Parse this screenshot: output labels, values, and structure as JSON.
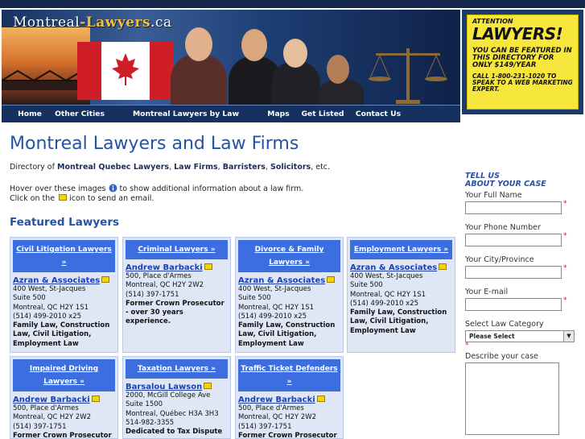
{
  "header": {
    "logo_main": "Montreal",
    "logo_accent": "-Lawyers",
    "logo_tld": ".ca"
  },
  "ad": {
    "line1": "ATTENTION",
    "line2": "LAWYERS!",
    "line3": "YOU CAN BE FEATURED IN THIS DIRECTORY FOR ONLY $149/YEAR",
    "line4": "CALL 1-800-231-1020 TO SPEAK TO A WEB MARKETING EXPERT."
  },
  "nav": {
    "items": [
      {
        "label": "Home"
      },
      {
        "label": "Other Cities"
      },
      {
        "label": "Montreal Lawyers by Law Category"
      },
      {
        "label": "Maps"
      },
      {
        "label": "Get Listed"
      },
      {
        "label": "Contact Us"
      }
    ]
  },
  "main": {
    "title": "Montreal Lawyers and Law Firms",
    "intro_prefix": "Directory of ",
    "intro_k1": "Montreal Quebec Lawyers",
    "intro_sep1": ", ",
    "intro_k2": "Law Firms",
    "intro_sep2": ", ",
    "intro_k3": "Barristers",
    "intro_sep3": ", ",
    "intro_k4": "Solicitors",
    "intro_suffix": ", etc.",
    "hover_prefix": "Hover over these images ",
    "hover_suffix": " to show additional information about a law firm.",
    "click_prefix": "Click on the ",
    "click_suffix": " icon to send an email.",
    "featured_heading": "Featured Lawyers"
  },
  "cards": [
    {
      "category": "Civil Litigation Lawyers »",
      "firm": "Azran & Associates",
      "address": [
        "400 West, St-Jacques",
        "Suite 500",
        "Montreal, QC H2Y 1S1",
        "(514) 499-2010 x25"
      ],
      "description": "Family Law, Construction Law, Civil Litigation, Employment Law"
    },
    {
      "category": "Criminal Lawyers »",
      "firm": "Andrew Barbacki",
      "address": [
        "500, Place d'Armes",
        "Montreal, QC H2Y 2W2",
        "(514) 397-1751"
      ],
      "description": "Former Crown Prosecutor - over 30 years experience."
    },
    {
      "category": "Divorce & Family Lawyers »",
      "firm": "Azran & Associates",
      "address": [
        "400 West, St-Jacques",
        "Suite 500",
        "Montreal, QC H2Y 1S1",
        "(514) 499-2010 x25"
      ],
      "description": "Family Law, Construction Law, Civil Litigation, Employment Law"
    },
    {
      "category": "Employment Lawyers »",
      "firm": "Azran & Associates",
      "address": [
        "400 West, St-Jacques",
        "Suite 500",
        "Montreal, QC H2Y 1S1",
        "(514) 499-2010 x25"
      ],
      "description": "Family Law, Construction Law, Civil Litigation, Employment Law"
    },
    {
      "category": "Impaired Driving Lawyers »",
      "firm": "Andrew Barbacki",
      "address": [
        "500, Place d'Armes",
        "Montreal, QC H2Y 2W2",
        "(514) 397-1751"
      ],
      "description": "Former Crown Prosecutor"
    },
    {
      "category": "Taxation Lawyers »",
      "firm": "Barsalou Lawson",
      "address": [
        "2000, McGill College Ave",
        "Suite 1500",
        "Montreal, Québec H3A 3H3",
        "514-982-3355"
      ],
      "description": "Dedicated to Tax Dispute"
    },
    {
      "category": "Traffic Ticket Defenders »",
      "firm": "Andrew Barbacki",
      "address": [
        "500, Place d'Armes",
        "Montreal, QC H2Y 2W2",
        "(514) 397-1751"
      ],
      "description": "Former Crown Prosecutor"
    }
  ],
  "sidebar": {
    "heading1": "TELL US",
    "heading2": "ABOUT YOUR CASE",
    "full_name_label": "Your Full Name",
    "phone_label": "Your Phone Number",
    "city_label": "Your City/Province",
    "email_label": "Your E-mail",
    "category_label": "Select Law Category",
    "category_selected": "Please Select",
    "describe_label": "Describe your case",
    "required_mark": "*"
  },
  "colors": {
    "accent_blue": "#2353a6",
    "nav_bg": "#16315f",
    "card_bg": "#dfe7f6",
    "category_bg": "#3c6ee0",
    "ad_yellow": "#f7e73c",
    "required_red": "#d0141a"
  },
  "icons": {
    "info": "info-circle-icon",
    "email": "envelope-icon",
    "select_arrow": "chevron-down-icon"
  }
}
